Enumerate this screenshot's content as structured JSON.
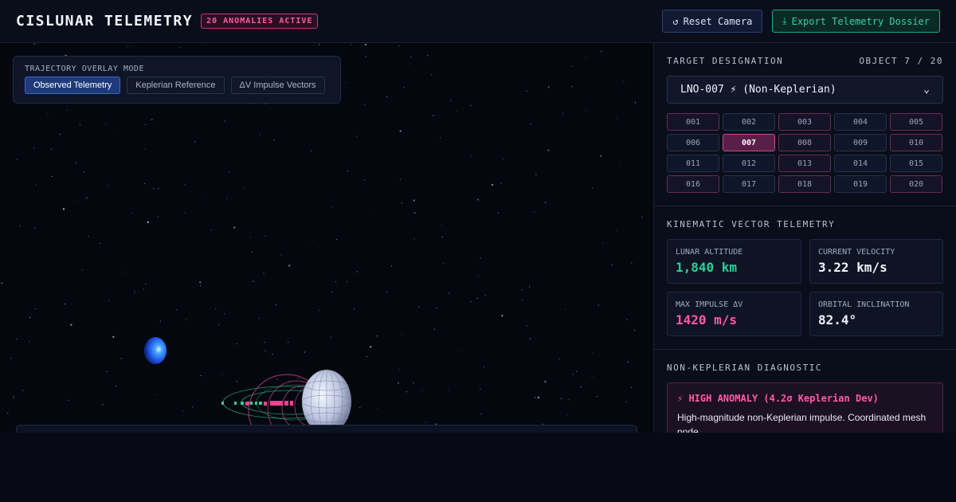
{
  "header": {
    "title": "CISLUNAR TELEMETRY",
    "anomaly_badge": "20 ANOMALIES ACTIVE",
    "reset_label": "Reset Camera",
    "reset_icon": "↺",
    "export_label": "Export Telemetry Dossier",
    "export_icon": "⤓"
  },
  "overlay": {
    "label": "TRAJECTORY OVERLAY MODE",
    "modes": [
      {
        "label": "Observed Telemetry",
        "active": true
      },
      {
        "label": "Keplerian Reference",
        "active": false
      },
      {
        "label": "ΔV Impulse Vectors",
        "active": false
      }
    ]
  },
  "target": {
    "title": "TARGET DESIGNATION",
    "counter": "OBJECT 7 / 20",
    "selected": "LNO-007 ⚡ (Non-Keplerian)",
    "objects": [
      {
        "id": "001",
        "anomaly": true
      },
      {
        "id": "002",
        "anomaly": false
      },
      {
        "id": "003",
        "anomaly": true
      },
      {
        "id": "004",
        "anomaly": false
      },
      {
        "id": "005",
        "anomaly": true
      },
      {
        "id": "006",
        "anomaly": false
      },
      {
        "id": "007",
        "anomaly": true,
        "selected": true
      },
      {
        "id": "008",
        "anomaly": true
      },
      {
        "id": "009",
        "anomaly": false
      },
      {
        "id": "010",
        "anomaly": true
      },
      {
        "id": "011",
        "anomaly": false
      },
      {
        "id": "012",
        "anomaly": false
      },
      {
        "id": "013",
        "anomaly": true
      },
      {
        "id": "014",
        "anomaly": false
      },
      {
        "id": "015",
        "anomaly": false
      },
      {
        "id": "016",
        "anomaly": true
      },
      {
        "id": "017",
        "anomaly": false
      },
      {
        "id": "018",
        "anomaly": true
      },
      {
        "id": "019",
        "anomaly": false
      },
      {
        "id": "020",
        "anomaly": true
      }
    ]
  },
  "kinematics": {
    "title": "KINEMATIC VECTOR TELEMETRY",
    "altitude_label": "LUNAR ALTITUDE",
    "altitude_value": "1,840 km",
    "velocity_label": "CURRENT VELOCITY",
    "velocity_value": "3.22 km/s",
    "impulse_label": "MAX IMPULSE ΔV",
    "impulse_value": "1420 m/s",
    "inclination_label": "ORBITAL INCLINATION",
    "inclination_value": "82.4°"
  },
  "diagnostic": {
    "title": "NON-KEPLERIAN DIAGNOSTIC",
    "alert_title": "⚡ HIGH ANOMALY (4.2σ Keplerian Dev)",
    "alert_text": "High-magnitude non-Keplerian impulse. Coordinated mesh node."
  },
  "colors": {
    "accent_pink": "#ff5aa8",
    "accent_green": "#2ecf95",
    "active_blue": "#1e3a78"
  }
}
